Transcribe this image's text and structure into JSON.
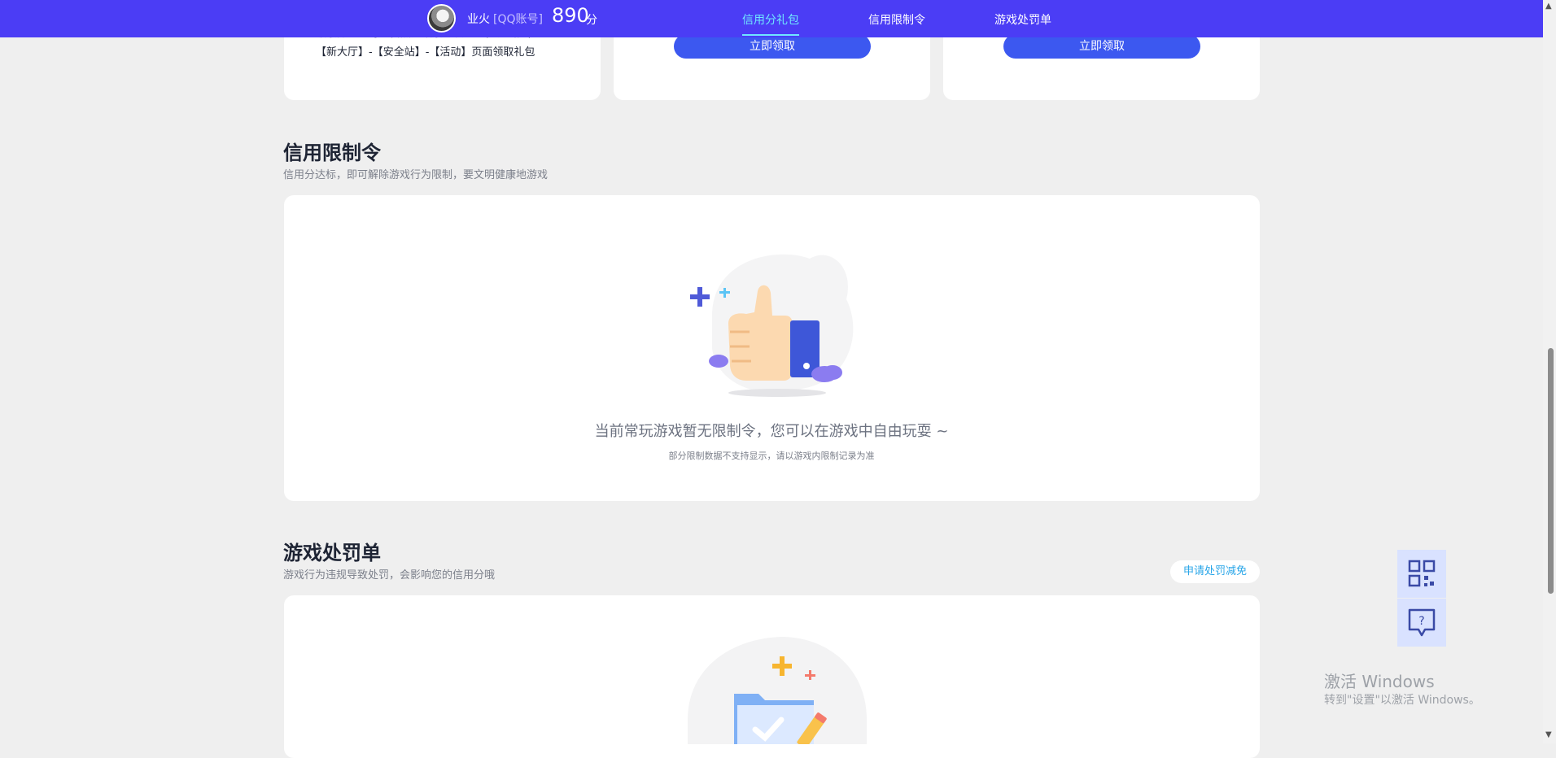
{
  "header": {
    "username": "业火",
    "account_type": "[QQ账号]",
    "score": "890",
    "score_unit": "分",
    "nav": [
      {
        "label": "信用分礼包",
        "active": true
      },
      {
        "label": "信用限制令",
        "active": false
      },
      {
        "label": "游戏处罚单",
        "active": false
      }
    ]
  },
  "gift_section": {
    "card1_text": "领取方式：每个自然月领取一次。前往游戏内，进入【新大厅】-【安全站】-【活动】页面领取礼包",
    "claim_label": "立即领取",
    "claim_label_2": "立即领取"
  },
  "restriction_section": {
    "title": "信用限制令",
    "subtitle": "信用分达标，即可解除游戏行为限制，要文明健康地游戏",
    "empty_message": "当前常玩游戏暂无限制令，您可以在游戏中自由玩耍 ~",
    "empty_note": "部分限制数据不支持显示，请以游戏内限制记录为准"
  },
  "penalty_section": {
    "title": "游戏处罚单",
    "subtitle": "游戏行为违规导致处罚，会影响您的信用分哦",
    "appeal_label": "申请处罚减免"
  },
  "watermark": {
    "line1": "激活 Windows",
    "line2": "转到\"设置\"以激活 Windows。"
  },
  "colors": {
    "topbar": "#4b3df5",
    "nav_active": "#6fe7ff",
    "button": "#3c58f0",
    "appeal_text": "#2aa6e8"
  },
  "icons": [
    "avatar",
    "thumbs-up-illustration",
    "folder-check-illustration",
    "qr-code-icon",
    "help-chat-icon"
  ]
}
